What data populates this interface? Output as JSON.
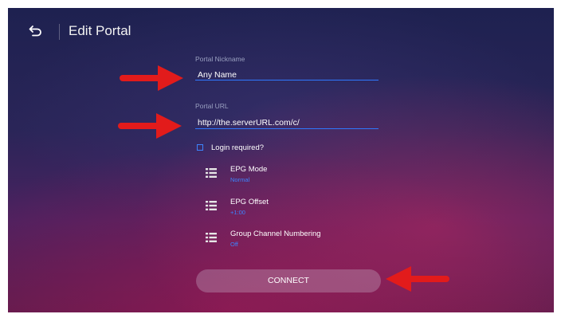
{
  "header": {
    "title": "Edit Portal",
    "back_icon": "back-arrow-icon"
  },
  "form": {
    "nickname": {
      "label": "Portal Nickname",
      "value": "Any Name"
    },
    "url": {
      "label": "Portal URL",
      "value": "http://the.serverURL.com/c/"
    },
    "login_required": {
      "label": "Login required?",
      "checked": false
    }
  },
  "settings": [
    {
      "title": "EPG Mode",
      "value": "Normal",
      "icon": "list-icon"
    },
    {
      "title": "EPG Offset",
      "value": "+1:00",
      "icon": "list-icon"
    },
    {
      "title": "Group Channel Numbering",
      "value": "Off",
      "icon": "list-icon"
    }
  ],
  "connect_button": {
    "label": "CONNECT"
  },
  "colors": {
    "accent": "#2f78ff",
    "annotation_arrow": "#e21b1b",
    "background": "#2a2558"
  }
}
